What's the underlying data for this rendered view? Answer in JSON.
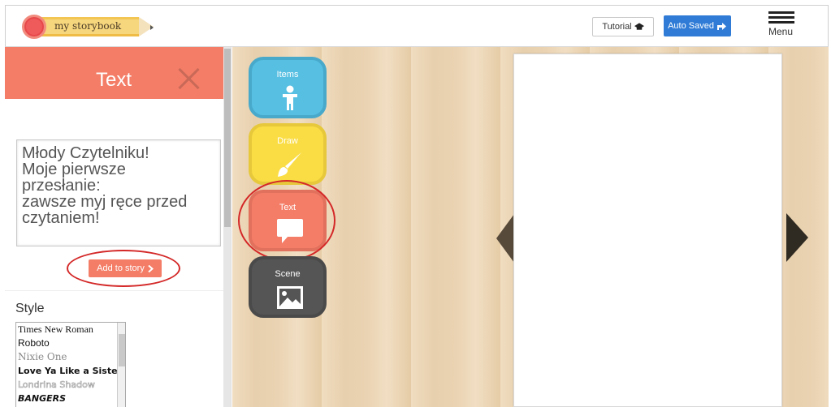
{
  "header": {
    "logo_text": "my storybook",
    "tutorial_label": "Tutorial",
    "autosaved_label": "Auto Saved",
    "menu_label": "Menu"
  },
  "left_panel": {
    "title": "Text",
    "textarea_lines": [
      "Młody Czytelniku!",
      "Moje pierwsze",
      "przesłanie:",
      "zawsze myj ręce przed",
      "czytaniem!"
    ],
    "add_button": "Add to story",
    "style_title": "Style",
    "fonts": [
      "Times New Roman",
      "Roboto",
      "Nixie One",
      "Love Ya Like a Sister",
      "Londrina Shadow",
      "BANGERS"
    ]
  },
  "tools": {
    "items": "Items",
    "draw": "Draw",
    "text": "Text",
    "scene": "Scene"
  },
  "colors": {
    "accent_coral": "#f47d67",
    "items_blue": "#56bfe2",
    "draw_yellow": "#fadd45",
    "scene_gray": "#555555",
    "autosaved_blue": "#2f7bd6",
    "annotation_red": "#d42828"
  },
  "icons": {
    "close": "close-icon",
    "items": "person-icon",
    "draw": "brush-icon",
    "text": "speech-bubble-icon",
    "scene": "image-icon",
    "tutorial": "graduation-cap-icon",
    "autosaved": "share-arrow-icon",
    "menu": "hamburger-icon"
  }
}
